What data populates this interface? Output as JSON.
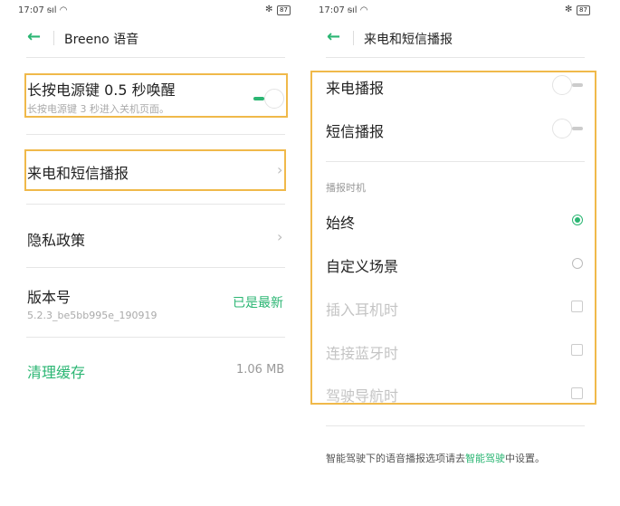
{
  "left": {
    "status": {
      "time": "17:07",
      "battery": "87"
    },
    "header": {
      "title": "Breeno 语音"
    },
    "items": [
      {
        "title": "长按电源键 0.5 秒唤醒",
        "subtitle": "长按电源键 3 秒进入关机页面。",
        "toggle_on": true
      },
      {
        "title": "来电和短信播报"
      },
      {
        "title": "隐私政策"
      },
      {
        "title": "版本号",
        "subtitle": "5.2.3_be5bb995e_190919",
        "value": "已是最新"
      },
      {
        "title": "清理缓存",
        "value": "1.06 MB"
      }
    ]
  },
  "right": {
    "status": {
      "time": "17:07",
      "battery": "87"
    },
    "header": {
      "title": "来电和短信播报"
    },
    "toggles": [
      {
        "label": "来电播报",
        "on": false
      },
      {
        "label": "短信播报",
        "on": false
      }
    ],
    "section_label": "播报时机",
    "radios": [
      {
        "label": "始终",
        "selected": true
      },
      {
        "label": "自定义场景",
        "selected": false
      }
    ],
    "checkboxes": [
      {
        "label": "插入耳机时",
        "enabled": false
      },
      {
        "label": "连接蓝牙时",
        "enabled": false
      },
      {
        "label": "驾驶导航时",
        "enabled": false
      }
    ],
    "footer": {
      "prefix": "智能驾驶下的语音播报选项请去",
      "link": "智能驾驶",
      "suffix": "中设置。"
    }
  },
  "colors": {
    "accent": "#2bb673",
    "highlight": "#f0b94a"
  }
}
